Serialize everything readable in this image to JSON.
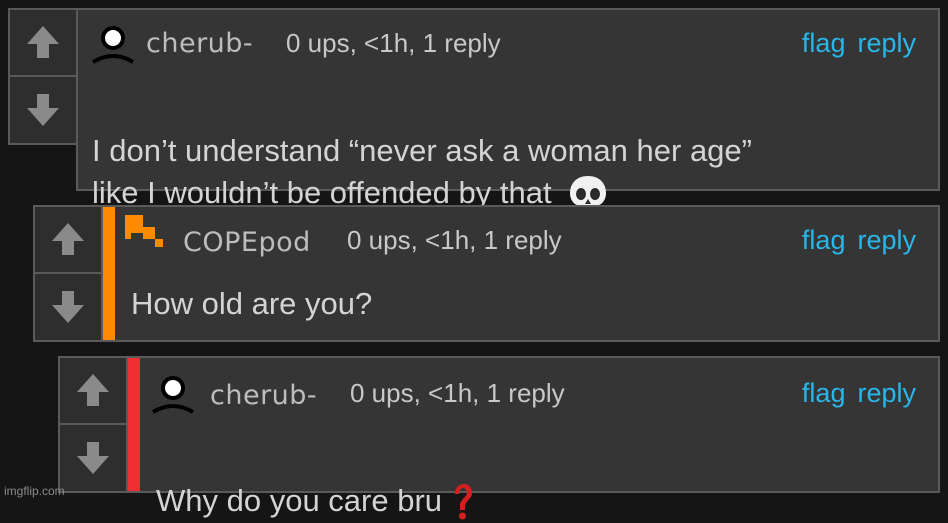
{
  "comments": [
    {
      "username": "cherub-",
      "meta": "0 ups, <1h, 1 reply",
      "flag": "flag",
      "reply": "reply",
      "text": "I don’t understand “never ask a woman her age”\nlike I wouldn’t be offended by that",
      "emoji": "skull-emoji"
    },
    {
      "username": "COPEpod",
      "meta": "0 ups, <1h, 1 reply",
      "flag": "flag",
      "reply": "reply",
      "text": "How old are you?",
      "stripe_color": "#ff8a00"
    },
    {
      "username": "cherub-",
      "meta": "0 ups, <1h, 1 reply",
      "flag": "flag",
      "reply": "reply",
      "text": "Why do you care bru",
      "emoji": "red-question-mark-emoji",
      "stripe_color": "#f03030"
    }
  ],
  "colors": {
    "background": "#151515",
    "panel": "#353535",
    "link": "#29b6e8",
    "border": "#5a5a5a"
  },
  "watermark": "imgflip.com"
}
